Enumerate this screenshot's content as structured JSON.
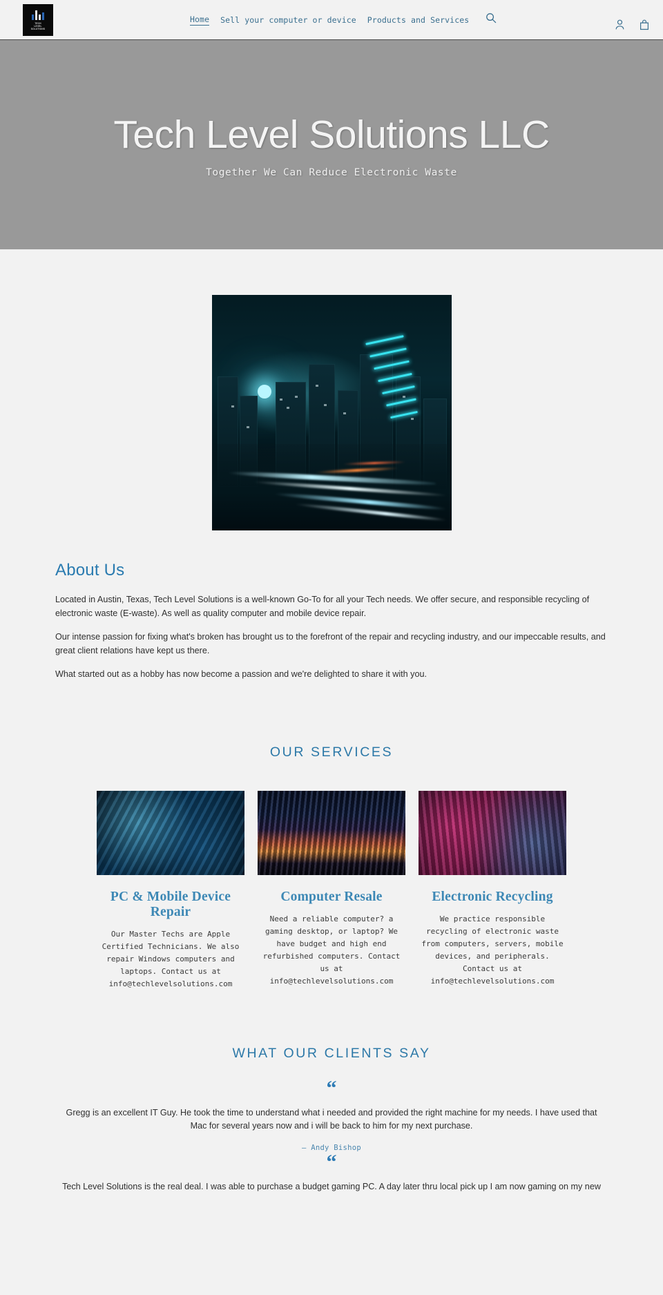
{
  "header": {
    "logo": {
      "name": "tech-level-solutions-logo",
      "line1": "TECH",
      "line2": "LEVEL",
      "line3": "SOLUTIONS"
    },
    "nav": [
      {
        "label": "Home",
        "active": true
      },
      {
        "label": "Sell your computer or device",
        "active": false
      },
      {
        "label": "Products and Services",
        "active": false
      }
    ],
    "icons": {
      "search": "search-icon",
      "account": "account-icon",
      "cart": "cart-icon"
    }
  },
  "hero": {
    "title": "Tech Level Solutions LLC",
    "subtitle": "Together We Can Reduce Electronic Waste",
    "background_color": "#999999"
  },
  "about": {
    "heading": "About Us",
    "paragraphs": [
      "Located in Austin, Texas, Tech Level Solutions is a well-known Go-To for all your Tech needs. We offer secure, and responsible recycling of electronic waste (E-waste). As well as quality computer and mobile device repair.",
      "Our intense passion for fixing what's broken has brought us to the forefront of the repair and recycling industry, and our impeccable results, and great client relations have kept us there.",
      "What started out as a hobby has now become a passion and we're delighted to share it with you."
    ]
  },
  "services": {
    "heading": "OUR SERVICES",
    "cards": [
      {
        "title": "PC & Mobile Device Repair",
        "body": "Our Master Techs are Apple Certified Technicians. We also repair Windows computers and laptops. Contact us at info@techlevelsolutions.com",
        "image": "circuit-board-photo"
      },
      {
        "title": "Computer Resale",
        "body": "Need a reliable computer? a gaming desktop, or laptop? We have budget and high end refurbished computers. Contact us at info@techlevelsolutions.com",
        "image": "rgb-keyboard-photo"
      },
      {
        "title": "Electronic Recycling",
        "body": "We practice responsible recycling of electronic waste from computers, servers, mobile devices, and peripherals. Contact us at info@techlevelsolutions.com",
        "image": "retro-computer-photo"
      }
    ]
  },
  "testimonials": {
    "heading": "WHAT OUR CLIENTS SAY",
    "quote_glyph": "“",
    "items": [
      {
        "text": "Gregg is an excellent IT Guy. He took the time to understand what i needed and provided the right machine for my needs. I have used that Mac for several years now and i will be back to him for my next purchase.",
        "author": "— Andy Bishop"
      },
      {
        "text": "Tech Level Solutions is the real deal. I was able to purchase a budget gaming PC. A day later thru local pick up I am now gaming on my new",
        "author": ""
      }
    ]
  },
  "colors": {
    "accent": "#2d79a8",
    "link": "#3a6f8f",
    "page_background": "#f2f2f2",
    "hero_background": "#999999"
  }
}
